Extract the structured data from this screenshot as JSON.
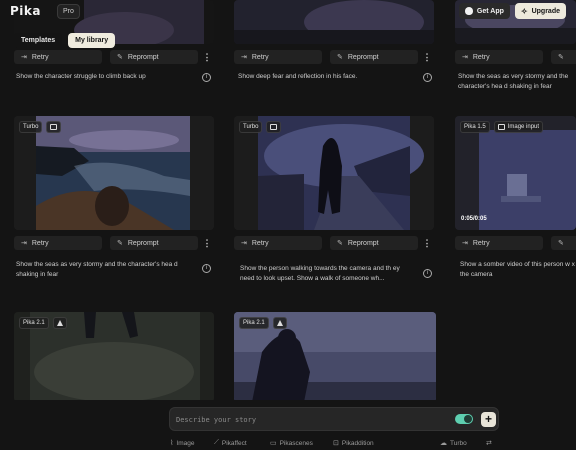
{
  "header": {
    "logo": "Pika",
    "plan_badge": "Pro",
    "get_app": "Get App",
    "upgrade": "Upgrade"
  },
  "tabs": [
    {
      "label": "Templates"
    },
    {
      "label": "My library"
    }
  ],
  "actions": {
    "retry": "Retry",
    "reprompt": "Reprompt"
  },
  "rows": [
    {
      "descriptions": [
        "Show the character struggle to climb back up",
        "Show deep fear and reflection in his face.",
        "Show the seas as very stormy and the character's hea d shaking in fear"
      ]
    },
    {
      "cards": [
        {
          "badges": [
            "Turbo"
          ]
        },
        {
          "badges": [
            "Turbo"
          ]
        },
        {
          "badges": [
            "Pika 1.5",
            "Image input"
          ],
          "timecode": "0:05/0:05"
        }
      ],
      "descriptions": [
        "Show the seas as very stormy and the character's hea d shaking in fear",
        "Show the person walking towards the camera and th ey need to look upset. Show a walk of someone wh...",
        "Show a somber video of this person w x the camera"
      ]
    },
    {
      "cards": [
        {
          "badges": [
            "Pika 2.1"
          ]
        },
        {
          "badges": [
            "Pika 2.1"
          ]
        }
      ]
    }
  ],
  "prompt": {
    "placeholder": "Describe your story"
  },
  "toolbar": [
    {
      "label": "Image",
      "icon": "paperclip-icon"
    },
    {
      "label": "Pikaffect",
      "icon": "wand-icon"
    },
    {
      "label": "Pikascenes",
      "icon": "scenes-icon"
    },
    {
      "label": "Pikaddition",
      "icon": "addition-icon"
    },
    {
      "label": "Turbo",
      "icon": "cloud-icon"
    }
  ]
}
